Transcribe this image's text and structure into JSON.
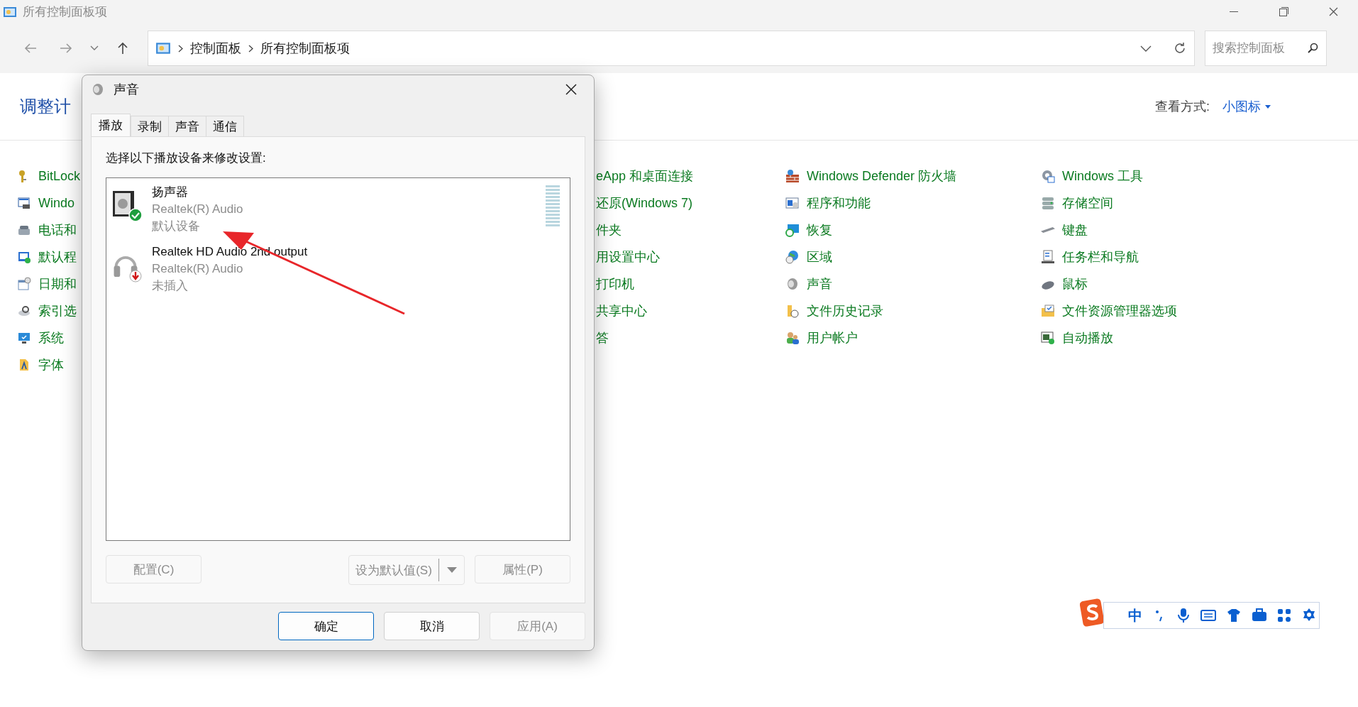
{
  "window": {
    "title": "所有控制面板项"
  },
  "address_bar": {
    "breadcrumb": [
      "控制面板",
      "所有控制面板项"
    ]
  },
  "search": {
    "placeholder": "搜索控制面板"
  },
  "header": {
    "title": "调整计",
    "view_label": "查看方式:",
    "view_value": "小图标"
  },
  "columns": [
    {
      "items": [
        "BitLock",
        "Windo",
        "电话和",
        "默认程",
        "日期和",
        "索引选",
        "系统",
        "字体"
      ]
    },
    {
      "items": [
        "eApp 和桌面连接",
        "还原(Windows 7)",
        "件夹",
        "用设置中心",
        "打印机",
        "共享中心",
        "答"
      ]
    },
    {
      "items": [
        "Windows Defender 防火墙",
        "程序和功能",
        "恢复",
        "区域",
        "声音",
        "文件历史记录",
        "用户帐户"
      ]
    },
    {
      "items": [
        "Windows 工具",
        "存储空间",
        "键盘",
        "任务栏和导航",
        "鼠标",
        "文件资源管理器选项",
        "自动播放"
      ]
    }
  ],
  "dialog": {
    "title": "声音",
    "tabs": [
      {
        "label": "播放",
        "selected": true
      },
      {
        "label": "录制",
        "selected": false
      },
      {
        "label": "声音",
        "selected": false
      },
      {
        "label": "通信",
        "selected": false
      }
    ],
    "instruction": "选择以下播放设备来修改设置:",
    "devices": [
      {
        "kind": "speaker",
        "name": "扬声器",
        "driver": "Realtek(R) Audio",
        "status": "默认设备",
        "default": true,
        "unplugged": false
      },
      {
        "kind": "headphones",
        "name": "Realtek HD Audio 2nd output",
        "driver": "Realtek(R) Audio",
        "status": "未插入",
        "default": false,
        "unplugged": true
      }
    ],
    "list_buttons": [
      {
        "label": "配置(C)",
        "kind": "plain",
        "disabled": true
      },
      {
        "label": "设为默认值(S)",
        "kind": "split",
        "disabled": true
      },
      {
        "label": "属性(P)",
        "kind": "plain",
        "disabled": true
      }
    ],
    "buttons": [
      {
        "label": "确定",
        "default": true,
        "disabled": false
      },
      {
        "label": "取消",
        "default": false,
        "disabled": false
      },
      {
        "label": "应用(A)",
        "default": false,
        "disabled": true
      }
    ]
  },
  "ime_toolbar": {
    "mode": "中"
  }
}
